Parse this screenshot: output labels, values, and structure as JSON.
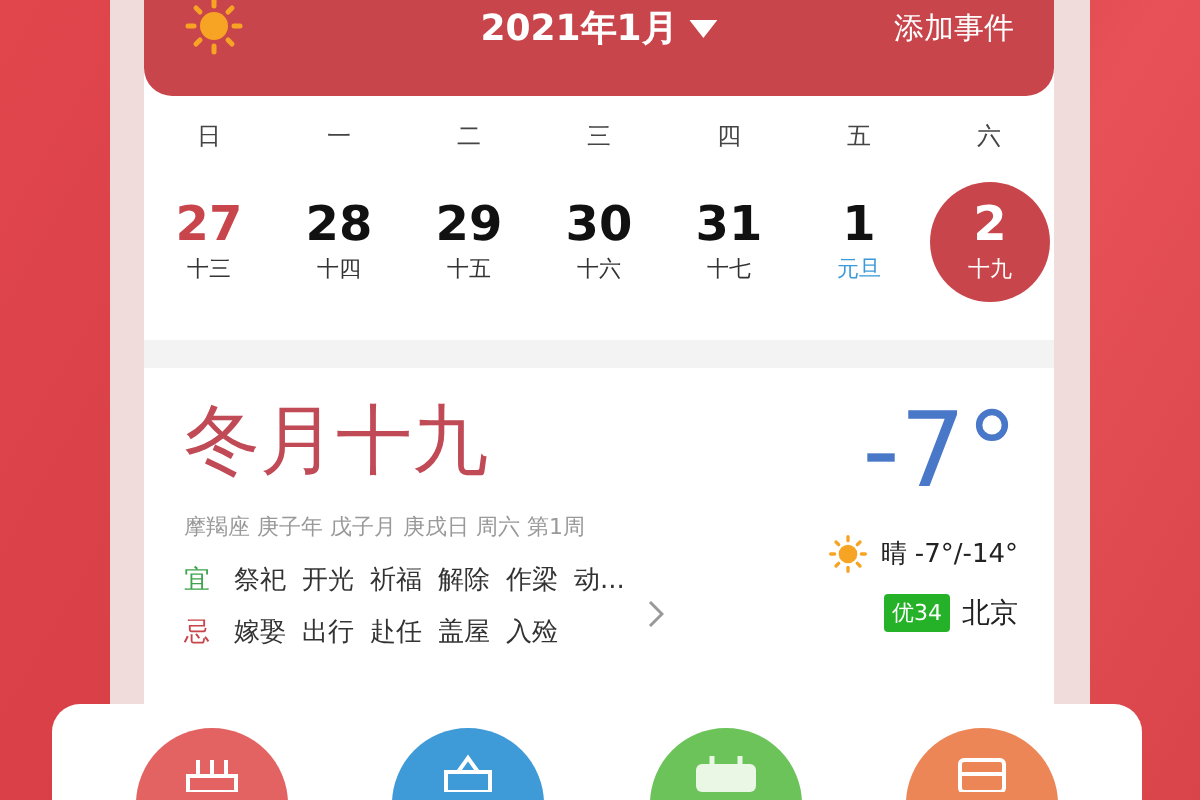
{
  "header": {
    "title": "2021年1月",
    "add_event": "添加事件"
  },
  "weekdays": [
    "日",
    "一",
    "二",
    "三",
    "四",
    "五",
    "六"
  ],
  "days": [
    {
      "date": "27",
      "lunar": "十三",
      "kind": "weekend",
      "selected": false
    },
    {
      "date": "28",
      "lunar": "十四",
      "kind": "normal",
      "selected": false
    },
    {
      "date": "29",
      "lunar": "十五",
      "kind": "normal",
      "selected": false
    },
    {
      "date": "30",
      "lunar": "十六",
      "kind": "normal",
      "selected": false
    },
    {
      "date": "31",
      "lunar": "十七",
      "kind": "normal",
      "selected": false
    },
    {
      "date": "1",
      "lunar": "元旦",
      "kind": "holiday",
      "selected": false
    },
    {
      "date": "2",
      "lunar": "十九",
      "kind": "normal",
      "selected": true
    }
  ],
  "detail": {
    "lunar_date": "冬月十九",
    "info": "摩羯座 庚子年 戊子月 庚戌日 周六 第1周",
    "yi": {
      "label": "宜",
      "items": [
        "祭祀",
        "开光",
        "祈福",
        "解除",
        "作梁",
        "动..."
      ]
    },
    "ji": {
      "label": "忌",
      "items": [
        "嫁娶",
        "出行",
        "赴任",
        "盖屋",
        "入殓"
      ]
    }
  },
  "weather": {
    "temperature": "-7°",
    "condition": "晴 -7°/-14°",
    "aqi": "优34",
    "city": "北京"
  },
  "shortcuts": [
    {
      "kind": "cake",
      "color": "#e36363"
    },
    {
      "kind": "bag",
      "color": "#3f9ad8"
    },
    {
      "kind": "calendar",
      "color": "#6cc35a"
    },
    {
      "kind": "list",
      "color": "#ec8656"
    }
  ]
}
